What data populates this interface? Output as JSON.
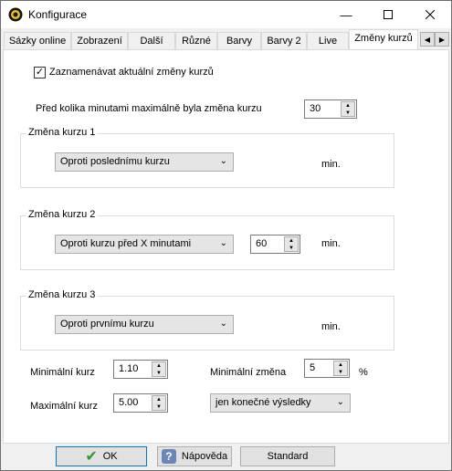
{
  "window": {
    "title": "Konfigurace",
    "minimize_icon": "minimize-icon",
    "maximize_icon": "maximize-icon",
    "close_icon": "close-icon"
  },
  "tabs": {
    "items": [
      "Sázky online",
      "Zobrazení",
      "Další",
      "Různé",
      "Barvy",
      "Barvy 2",
      "Live",
      "Změny kurzů"
    ],
    "active": "Změny kurzů",
    "scroll_left": "◀",
    "scroll_right": "▶"
  },
  "settings": {
    "record_label": "Zaznamenávat aktuální změny kurzů",
    "record_checked": true,
    "max_minutes_label": "Před kolika minutami maximálně byla změna kurzu",
    "max_minutes_value": "30"
  },
  "groups": [
    {
      "title": "Změna kurzu 1",
      "select_value": "Oproti poslednímu kurzu",
      "unit": "min."
    },
    {
      "title": "Změna kurzu 2",
      "select_value": "Oproti kurzu před X minutami",
      "minutes_value": "60",
      "unit": "min."
    },
    {
      "title": "Změna kurzu 3",
      "select_value": "Oproti prvnímu kurzu",
      "unit": "min."
    }
  ],
  "limits": {
    "min_odds_label": "Minimální kurz",
    "min_odds_value": "1.10",
    "max_odds_label": "Maximální kurz",
    "max_odds_value": "5.00",
    "min_change_label": "Minimální změna",
    "min_change_value": "5",
    "min_change_unit": "%",
    "results_select": "jen konečné výsledky"
  },
  "footer": {
    "ok_label": "OK",
    "help_label": "Nápověda",
    "standard_label": "Standard"
  },
  "colors": {
    "ok_check": "#2e9b2e",
    "help_icon_bg": "#6b87b7",
    "default_border": "#0078d7"
  }
}
